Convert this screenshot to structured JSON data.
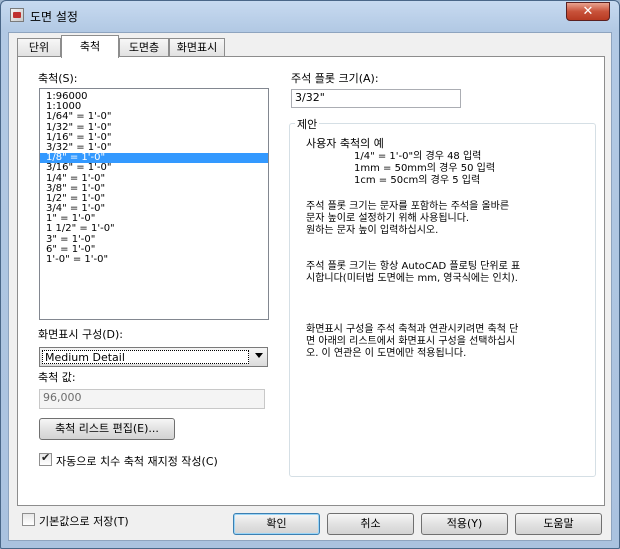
{
  "window": {
    "title": "도면 설정",
    "close_glyph": "✕"
  },
  "tabs": [
    {
      "label": "단위"
    },
    {
      "label": "축척"
    },
    {
      "label": "도면층"
    },
    {
      "label": "화면표시"
    }
  ],
  "scale_section": {
    "label": "축척(S):",
    "items": [
      "1:96000",
      "1:1000",
      "1/64\" = 1'-0\"",
      "1/32\" = 1'-0\"",
      "1/16\" = 1'-0\"",
      "3/32\" = 1'-0\"",
      "1/8\" = 1'-0\"",
      "3/16\" = 1'-0\"",
      "1/4\" = 1'-0\"",
      "3/8\" = 1'-0\"",
      "1/2\" = 1'-0\"",
      "3/4\" = 1'-0\"",
      "1\" = 1'-0\"",
      "1 1/2\" = 1'-0\"",
      "3\" = 1'-0\"",
      "6\" = 1'-0\"",
      "1'-0\" = 1'-0\""
    ],
    "selected_index": 6
  },
  "display_config": {
    "label": "화면표시 구성(D):",
    "selected": "Medium Detail"
  },
  "scale_value": {
    "label": "축척 값:",
    "value": "96,000"
  },
  "edit_scale_list_button": "축척 리스트 편집(E)...",
  "auto_dimscale": {
    "label": "자동으로 치수 축척 재지정 작성(C)",
    "checked": true
  },
  "annotation_plot_size": {
    "label": "주석 플롯 크기(A):",
    "value": "3/32\""
  },
  "suggestion": {
    "title": "제안",
    "example_heading": "사용자 축척의 예",
    "example_lines": [
      "1/4\" = 1'-0\"의 경우 48 입력",
      "1mm = 50mm의 경우 50 입력",
      "1cm = 50cm의 경우 5 입력"
    ],
    "para1": [
      "주석 플롯 크기는 문자를 포함하는 주석을 올바른",
      "문자 높이로 설정하기 위해 사용됩니다.",
      "원하는 문자 높이 입력하십시오."
    ],
    "para2": [
      "주석 플롯 크기는 항상 AutoCAD 플로팅 단위로 표",
      "시합니다(미터법 도면에는 mm, 영국식에는 인치)."
    ],
    "para3": [
      "화면표시 구성을 주석 축척과 연관시키려면 축척 단",
      "면 아래의 리스트에서 화면표시 구성을 선택하십시",
      "오. 이 연관은 이 도면에만 적용됩니다."
    ]
  },
  "save_default": {
    "label": "기본값으로 저장(T)",
    "checked": false
  },
  "buttons": {
    "ok": "확인",
    "cancel": "취소",
    "apply": "적용(Y)",
    "help": "도움말"
  }
}
